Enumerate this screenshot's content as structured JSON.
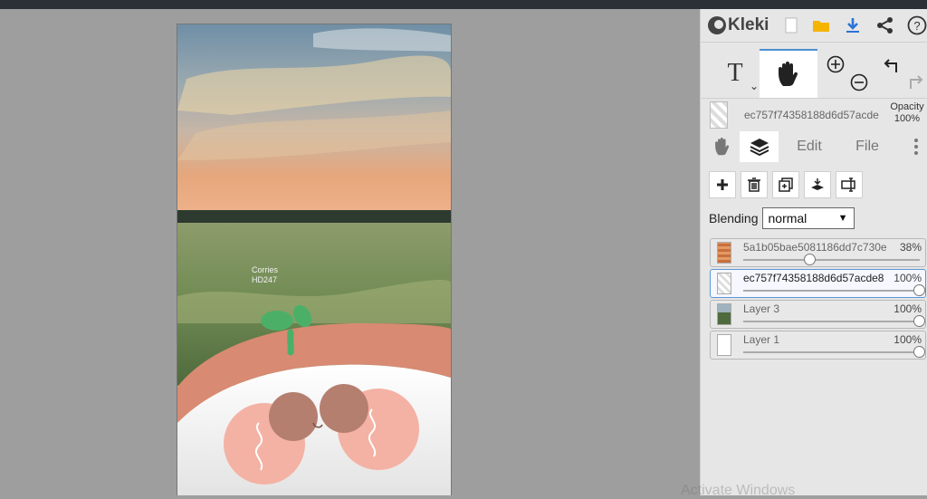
{
  "app": {
    "title": "Kleki"
  },
  "header_icons": [
    "new-image-icon",
    "open-folder-icon",
    "download-icon",
    "share-icon",
    "help-icon"
  ],
  "tools": {
    "text_glyph": "T",
    "zoom": "zoom-in-out"
  },
  "active_layer": {
    "name": "ec757f74358188d6d57acde",
    "opacity_label": "Opacity",
    "opacity_value": "100%"
  },
  "tabs": {
    "edit": "Edit",
    "file": "File"
  },
  "blending": {
    "label": "Blending",
    "value": "normal"
  },
  "layers": [
    {
      "name": "5a1b05bae5081186dd7c730e",
      "opacity": "38%",
      "level": 0.38
    },
    {
      "name": "ec757f74358188d6d57acde8",
      "opacity": "100%",
      "level": 1.0
    },
    {
      "name": "Layer 3",
      "opacity": "100%",
      "level": 1.0
    },
    {
      "name": "Layer 1",
      "opacity": "100%",
      "level": 1.0
    }
  ],
  "canvas": {
    "caption_line1": "Corries",
    "caption_line2": "HD247"
  },
  "watermark": "Activate Windows",
  "colors": {
    "accent": "#4d8fd1",
    "panel_bg": "#e6e6e6",
    "download": "#2b73d6",
    "folder": "#f4b400"
  }
}
